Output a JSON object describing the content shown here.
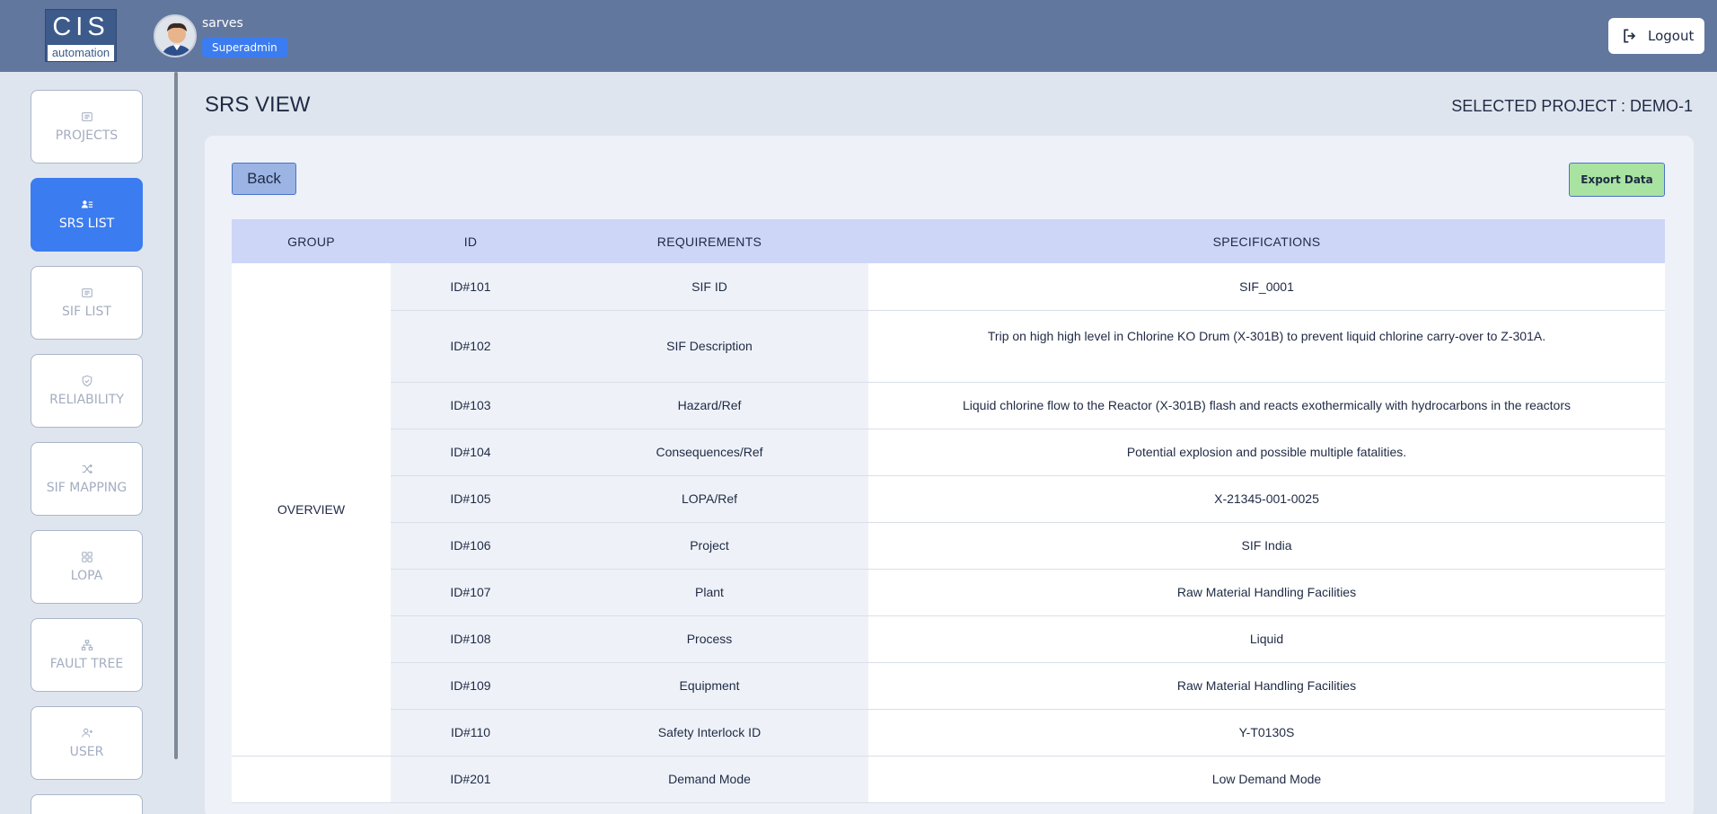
{
  "header": {
    "logo_top": "CIS",
    "logo_bottom": "automation",
    "username": "sarves",
    "role": "Superadmin",
    "logout_label": "Logout"
  },
  "sidebar": {
    "items": [
      {
        "label": "PROJECTS",
        "icon": "list-icon",
        "active": false
      },
      {
        "label": "SRS LIST",
        "icon": "users-list-icon",
        "active": true
      },
      {
        "label": "SIF LIST",
        "icon": "list-icon",
        "active": false
      },
      {
        "label": "RELIABILITY",
        "icon": "shield-check-icon",
        "active": false
      },
      {
        "label": "SIF MAPPING",
        "icon": "shuffle-icon",
        "active": false
      },
      {
        "label": "LOPA",
        "icon": "grid-icon",
        "active": false
      },
      {
        "label": "FAULT TREE",
        "icon": "hierarchy-icon",
        "active": false
      },
      {
        "label": "USER",
        "icon": "user-plus-icon",
        "active": false
      }
    ]
  },
  "main": {
    "title": "SRS VIEW",
    "selected_project": "SELECTED PROJECT : DEMO-1",
    "back_label": "Back",
    "export_label": "Export Data"
  },
  "table": {
    "headers": [
      "GROUP",
      "ID",
      "REQUIREMENTS",
      "SPECIFICATIONS"
    ],
    "group_overview": "OVERVIEW",
    "rows": [
      {
        "id": "ID#101",
        "requirement": "SIF ID",
        "specification": "SIF_0001"
      },
      {
        "id": "ID#102",
        "requirement": "SIF Description",
        "specification": "Trip on high high level in Chlorine KO Drum (X-301B) to prevent liquid chlorine carry-over to Z-301A."
      },
      {
        "id": "ID#103",
        "requirement": "Hazard/Ref",
        "specification": "Liquid chlorine flow to the Reactor (X-301B) flash and reacts exothermically with hydrocarbons in the reactors"
      },
      {
        "id": "ID#104",
        "requirement": "Consequences/Ref",
        "specification": "Potential explosion and possible multiple fatalities."
      },
      {
        "id": "ID#105",
        "requirement": "LOPA/Ref",
        "specification": "X-21345-001-0025"
      },
      {
        "id": "ID#106",
        "requirement": "Project",
        "specification": "SIF India"
      },
      {
        "id": "ID#107",
        "requirement": "Plant",
        "specification": "Raw Material Handling Facilities"
      },
      {
        "id": "ID#108",
        "requirement": "Process",
        "specification": "Liquid"
      },
      {
        "id": "ID#109",
        "requirement": "Equipment",
        "specification": "Raw Material Handling Facilities"
      },
      {
        "id": "ID#110",
        "requirement": "Safety Interlock ID",
        "specification": "Y-T0130S"
      },
      {
        "id": "ID#201",
        "requirement": "Demand Mode",
        "specification": "Low Demand Mode"
      }
    ]
  },
  "colors": {
    "header_bg": "#62779e",
    "accent": "#3b7cf0",
    "table_header_bg": "#cdd6f7",
    "export_bg": "#a8e3a2",
    "back_bg": "#9cb4e4"
  }
}
